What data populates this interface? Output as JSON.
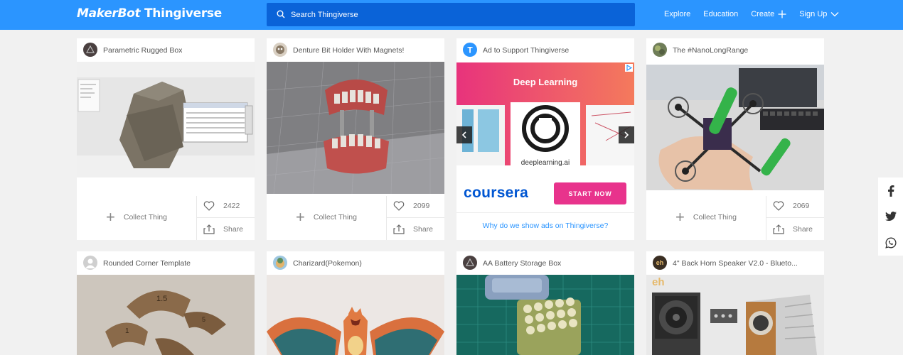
{
  "header": {
    "logo_maker": "MakerBot",
    "logo_thing": "Thingiverse",
    "search_placeholder": "Search Thingiverse",
    "nav": {
      "explore": "Explore",
      "education": "Education",
      "create": "Create",
      "signup": "Sign Up"
    }
  },
  "cards": [
    {
      "title": "Parametric Rugged Box",
      "collect": "Collect Thing",
      "likes": "2422",
      "share": "Share"
    },
    {
      "title": "Denture Bit Holder With Magnets!",
      "collect": "Collect Thing",
      "likes": "2099",
      "share": "Share"
    },
    {
      "title": "Ad to Support Thingiverse",
      "ad_heading": "Deep Learning",
      "ad_site": "deeplearning.ai",
      "ad_brand": "coursera",
      "ad_cta": "START NOW",
      "ad_link": "Why do we show ads on Thingiverse?"
    },
    {
      "title": "The #NanoLongRange",
      "collect": "Collect Thing",
      "likes": "2069",
      "share": "Share"
    },
    {
      "title": "Rounded Corner Template"
    },
    {
      "title": "Charizard(Pokemon)"
    },
    {
      "title": "AA Battery Storage Box"
    },
    {
      "title": "4\" Back Horn Speaker V2.0 - Blueto...",
      "avatar_text": "eh",
      "image_logo": "eh"
    }
  ],
  "colors": {
    "brand": "#2b95ff",
    "search_bg": "#0a63d8",
    "coursera": "#0056d2",
    "ad_cta": "#e8338c"
  },
  "icons": [
    "search-icon",
    "plus-icon",
    "chevron-down-icon",
    "heart-icon",
    "share-icon",
    "facebook-icon",
    "twitter-icon",
    "whatsapp-icon",
    "ad-choices-icon",
    "carousel-prev-icon",
    "carousel-next-icon"
  ]
}
